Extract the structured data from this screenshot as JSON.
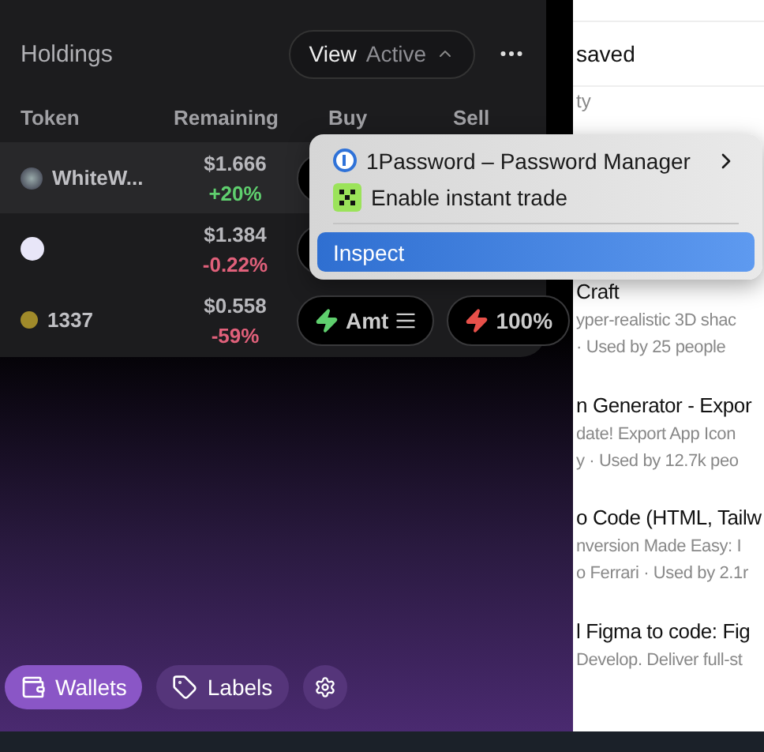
{
  "holdings": {
    "title": "Holdings",
    "view_label": "View",
    "view_value": "Active",
    "columns": [
      "Token",
      "Remaining",
      "Buy",
      "Sell"
    ],
    "rows": [
      {
        "kind": "gain",
        "token": "WhiteW...",
        "value": "$1.666",
        "change": "+20%",
        "highlighted": true
      },
      {
        "kind": "loss",
        "value": "$1.384",
        "change": "-0.22%",
        "highlighted": false
      },
      {
        "kind": "loss",
        "token": "1337",
        "value": "$0.558",
        "change": "-59%",
        "highlighted": false,
        "buy": "Amt",
        "sell": "100%"
      }
    ]
  },
  "context_menu": {
    "items": [
      {
        "kind": "item",
        "label": "1Password – Password Manager",
        "submenu": true,
        "selected": false
      },
      {
        "kind": "item",
        "label": "Enable instant trade",
        "submenu": false,
        "selected": false
      },
      {
        "kind": "divider"
      },
      {
        "kind": "item",
        "label": "Inspect",
        "submenu": false,
        "selected": true
      }
    ]
  },
  "bottom_nav": [
    {
      "kind": "text",
      "label": "Wallets",
      "selected": true
    },
    {
      "kind": "text",
      "label": "Labels",
      "selected": false
    },
    {
      "kind": "icon",
      "selected": false
    }
  ],
  "side_panel": {
    "header": "saved",
    "subheader": "ty",
    "entries": [
      {
        "title": "Craft",
        "description": "yper-realistic 3D shac",
        "meta": "· Used by 25 people"
      },
      {
        "title": "n Generator - Expor",
        "description": "date! Export App Icon",
        "meta": "y · Used by 12.7k peo"
      },
      {
        "title": "o Code (HTML, Tailw",
        "description": "nversion Made Easy: I",
        "meta": "o Ferrari · Used by 2.1r"
      },
      {
        "title": "l Figma to code: Fig",
        "description": "Develop. Deliver full-st"
      }
    ]
  }
}
